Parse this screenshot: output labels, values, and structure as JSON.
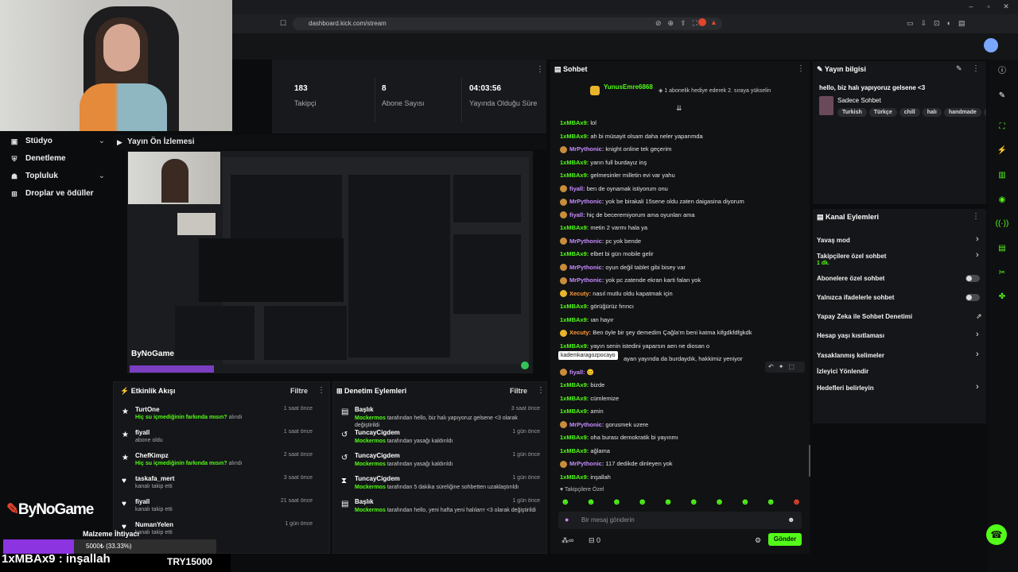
{
  "browser": {
    "url": "dashboard.kick.com/stream"
  },
  "stats": [
    {
      "value": "183",
      "label": "Takipçi"
    },
    {
      "value": "8",
      "label": "Abone Sayısı"
    },
    {
      "value": "04:03:56",
      "label": "Yayında Olduğu Süre"
    }
  ],
  "nav": {
    "items": [
      {
        "label": "Stüdyo",
        "icon": "studio-icon"
      },
      {
        "label": "Denetleme",
        "icon": "shield-icon"
      },
      {
        "label": "Topluluk",
        "icon": "community-icon"
      },
      {
        "label": "Droplar ve ödüller",
        "icon": "gift-icon"
      }
    ]
  },
  "preview": {
    "title": "Yayın Ön İzlemesi",
    "logo": "ByNoGame"
  },
  "activity": {
    "title": "Etkinlik Akışı",
    "filter": "Filtre",
    "items": [
      {
        "name": "TurtOne",
        "sub_em": "Hiç su içmediğinin farkında mısın?",
        "sub": " alındı",
        "time": "1 saat önce"
      },
      {
        "name": "fiyall",
        "sub_em": "",
        "sub": "abone oldu",
        "time": "1 saat önce"
      },
      {
        "name": "ChefKimpz",
        "sub_em": "Hiç su içmediğinin farkında mısın?",
        "sub": " alındı",
        "time": "2 saat önce"
      },
      {
        "name": "taskafa_mert",
        "sub_em": "",
        "sub": "kanalı takip etti",
        "time": "3 saat önce"
      },
      {
        "name": "fiyall",
        "sub_em": "",
        "sub": "kanalı takip etti",
        "time": "21 saat önce"
      },
      {
        "name": "NumanYelen",
        "sub_em": "",
        "sub": "kanalı takip etti",
        "time": "1 gün önce"
      }
    ]
  },
  "moderation": {
    "title": "Denetim Eylemleri",
    "filter": "Filtre",
    "items": [
      {
        "name": "Başlık",
        "sub_em": "Mockermos",
        "sub": " tarafından hello, biz halı yapıyoruz gelsene <3 olarak değiştirildi",
        "time": "3 saat önce"
      },
      {
        "name": "TuncayCigdem",
        "sub_em": "Mockermos",
        "sub": " tarafından yasağı kaldırıldı",
        "time": "1 gün önce"
      },
      {
        "name": "TuncayCigdem",
        "sub_em": "Mockermos",
        "sub": " tarafından yasağı kaldırıldı",
        "time": "1 gün önce"
      },
      {
        "name": "TuncayCigdem",
        "sub_em": "Mockermos",
        "sub": " tarafından 5 dakika süreliğine sohbetten uzaklaştırıldı",
        "time": "1 gün önce"
      },
      {
        "name": "Başlık",
        "sub_em": "Mockermos",
        "sub": " tarafından hello, yeni hafta yeni halılarrr <3 olarak değiştirildi",
        "time": "1 gün önce"
      }
    ]
  },
  "chat": {
    "title": "Sohbet",
    "pinned_user": "YunusEmre6868",
    "pinned_text": "1 abonelik hediye ederek 2. sıraya yükselin",
    "tooltip": "kademkaragozpocayo",
    "messages": [
      {
        "user": "1xMBAx9",
        "color": "#53fc18",
        "text": "lol"
      },
      {
        "user": "1xMBAx9",
        "color": "#53fc18",
        "text": "ah bi müsayit olsam daha neler yaparımda"
      },
      {
        "user": "MrPythonic",
        "color": "#c58cff",
        "text": "knight online tek geçerim"
      },
      {
        "user": "1xMBAx9",
        "color": "#53fc18",
        "text": "yarın full burdayız inş"
      },
      {
        "user": "1xMBAx9",
        "color": "#53fc18",
        "text": "gelmesinler milletin evi var yahu"
      },
      {
        "user": "fiyall",
        "color": "#c58cff",
        "text": "ben de oynamak istiyorum onu"
      },
      {
        "user": "MrPythonic",
        "color": "#c58cff",
        "text": "yok be birakali 15sene oldu zaten daigasina diyorum"
      },
      {
        "user": "fiyall",
        "color": "#c58cff",
        "text": "hiç de beceremiyorum ama oyunları ama"
      },
      {
        "user": "1xMBAx9",
        "color": "#53fc18",
        "text": "metin 2 varmı hala ya"
      },
      {
        "user": "MrPythonic",
        "color": "#c58cff",
        "text": "pc yok bende"
      },
      {
        "user": "1xMBAx9",
        "color": "#53fc18",
        "text": "elbet bi gün mobile gelir"
      },
      {
        "user": "MrPythonic",
        "color": "#c58cff",
        "text": "oyun değil tablet gibi bisey var"
      },
      {
        "user": "MrPythonic",
        "color": "#c58cff",
        "text": "yok pc zatende ekran karti falan yok"
      },
      {
        "user": "Xecuty",
        "color": "#ff9b3a",
        "text": "nasıl mutlu oldu kapatmak için"
      },
      {
        "user": "1xMBAx9",
        "color": "#53fc18",
        "text": "görüğürüz fırıncı"
      },
      {
        "user": "1xMBAx9",
        "color": "#53fc18",
        "text": "ıan hayır"
      },
      {
        "user": "Xecuty",
        "color": "#ff9b3a",
        "text": "Ben öyle bir şey demedim Çağla'm beni katma kifgdkfdfgkdk"
      },
      {
        "user": "1xMBAx9",
        "color": "#53fc18",
        "text": "yayın senin istedini yaparsın aen ne diosan o"
      },
      {
        "user": "",
        "color": "#53fc18",
        "text": "ayan yayında da burdaydık, hakkimiz yeniyor"
      },
      {
        "user": "fiyall",
        "color": "#c58cff",
        "text": "😊"
      },
      {
        "user": "1xMBAx9",
        "color": "#53fc18",
        "text": "bizde"
      },
      {
        "user": "1xMBAx9",
        "color": "#53fc18",
        "text": "cümlemize"
      },
      {
        "user": "1xMBAx9",
        "color": "#53fc18",
        "text": "amin"
      },
      {
        "user": "MrPythonic",
        "color": "#c58cff",
        "text": "gorusmek uzere"
      },
      {
        "user": "1xMBAx9",
        "color": "#53fc18",
        "text": "oha burası demokratik bi yayınmı"
      },
      {
        "user": "1xMBAx9",
        "color": "#53fc18",
        "text": "ağlama"
      },
      {
        "user": "MrPythonic",
        "color": "#c58cff",
        "text": "117 dedikde dinleyen yok"
      },
      {
        "user": "1xMBAx9",
        "color": "#53fc18",
        "text": "inşallah"
      }
    ],
    "followers_only": "Takipçilere Özel",
    "input_placeholder": "Bir mesaj gönderin",
    "count": "0",
    "send_label": "Gönder"
  },
  "info": {
    "title": "Yayın bilgisi",
    "stream_title": "hello, biz halı yapıyoruz gelsene <3",
    "category": "Sadece Sohbet",
    "tags": [
      "Turkish",
      "Türkçe",
      "chill",
      "halı",
      "handmade",
      "r"
    ]
  },
  "channel_actions": {
    "title": "Kanal Eylemleri",
    "items": [
      {
        "label": "Yavaş mod",
        "control": "arrow"
      },
      {
        "label": "Takipçilere özel sohbet",
        "sub": "1 dk.",
        "control": "arrow"
      },
      {
        "label": "Abonelere özel sohbet",
        "control": "toggle"
      },
      {
        "label": "Yalnızca ifadelerle sohbet",
        "control": "toggle"
      },
      {
        "label": "Yapay Zeka ile Sohbet Denetimi",
        "control": "link"
      },
      {
        "label": "Hesap yaşı kısıtlaması",
        "control": "arrow"
      },
      {
        "label": "Yasaklanmış kelimeler",
        "control": "arrow"
      },
      {
        "label": "İzleyici Yönlendir",
        "control": "none"
      },
      {
        "label": "Hedefleri belirleyin",
        "control": "arrow"
      }
    ]
  },
  "overlay": {
    "logo": "ByNoGame",
    "goal_label": "Malzeme İhtiyacı",
    "goal_text": "5000₺ (33.33%)",
    "goal_fraction": 0.3333,
    "ticker_user": "1xMBAx9 : inşallah",
    "ticker_amount": "TRY15000"
  },
  "colors": {
    "accent": "#53fc18",
    "panel": "#151619"
  }
}
